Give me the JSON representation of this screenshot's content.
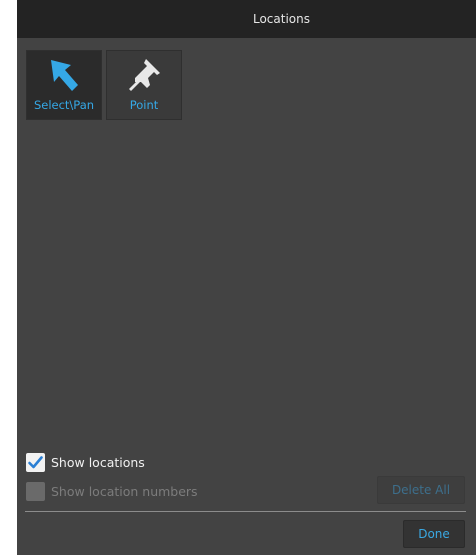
{
  "window": {
    "title": "Locations"
  },
  "tools": [
    {
      "label": "Select\\Pan",
      "icon": "arrow-cursor-icon",
      "selected": true
    },
    {
      "label": "Point",
      "icon": "pushpin-icon",
      "selected": false
    }
  ],
  "options": {
    "show_locations": {
      "label": "Show locations",
      "checked": true
    },
    "show_location_numbers": {
      "label": "Show location numbers",
      "checked": false,
      "enabled": false
    }
  },
  "buttons": {
    "delete_all": "Delete All",
    "done": "Done"
  },
  "colors": {
    "accent": "#35a8e6",
    "panel": "#434343",
    "titlebar": "#232323",
    "checkmark": "#2a7fd4"
  }
}
